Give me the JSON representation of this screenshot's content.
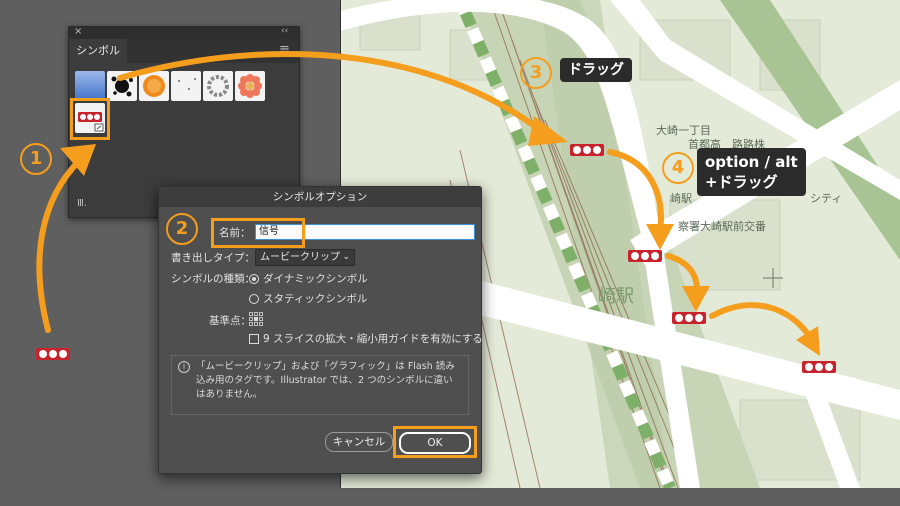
{
  "panel": {
    "tab_label": "シンボル",
    "close_glyph": "×",
    "collapse_glyph": "‹‹",
    "menu_glyph": "≡",
    "library_glyph": "Ⅲ."
  },
  "dialog": {
    "title": "シンボルオプション",
    "name_label": "名前：",
    "name_value": "信号",
    "export_type_label": "書き出しタイプ：",
    "export_type_value": "ムービークリップ",
    "symbol_type_label": "シンボルの種類：",
    "dynamic_label": "ダイナミックシンボル",
    "static_label": "スタティックシンボル",
    "registration_label": "基準点：",
    "nine_slice_label": "9 スライスの拡大・縮小用ガイドを有効にする",
    "info_text": "「ムービークリップ」および「グラフィック」は Flash 読み込み用のタグです。Illustrator では、2 つのシンボルに違いはありません。",
    "cancel_label": "キャンセル",
    "ok_label": "OK"
  },
  "annotations": {
    "step1": "1",
    "step2": "2",
    "step3": "3",
    "step4": "4",
    "drag_label": "ドラッグ",
    "option_drag_line1": "option / alt",
    "option_drag_line2": "+ドラッグ",
    "accent_color": "#f59d1d"
  },
  "map": {
    "label_ohsaki": "大崎一丁目",
    "label_highway": "首都高　路路株",
    "label_station_front": "崎駅",
    "label_police": "察署大崎駅前交番",
    "label_big": "崎駅",
    "label_city": "シティ",
    "label_yama": "ー",
    "signal_color": "#c8222d"
  }
}
